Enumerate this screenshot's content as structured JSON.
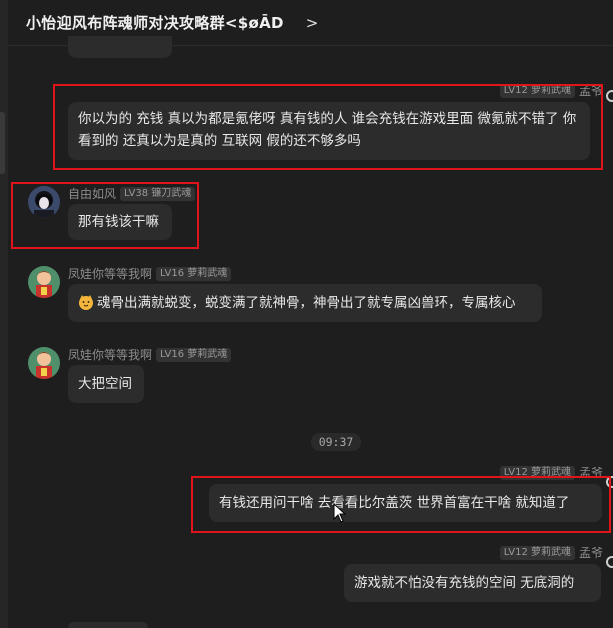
{
  "header": {
    "title": "小怡迎风布阵魂师对决攻略群<$øĀD",
    "chevron": ">"
  },
  "messages": [
    {
      "id": "m1",
      "side": "right",
      "name": "孟爷",
      "badge": "LV12 萝莉武魂",
      "text": "你以为的  充钱  真以为都是氪佬呀  真有钱的人  谁会充钱在游戏里面  微氪就不错了  你看到的  还真以为是真的  互联网  假的还不够多吗"
    },
    {
      "id": "m2",
      "side": "left",
      "name": "自由如风",
      "badge": "LV38 镰刀武魂",
      "avatar_icon": "dark-anime-avatar-icon",
      "text": "那有钱该干嘛"
    },
    {
      "id": "m3",
      "side": "left",
      "name": "凤娃你等等我啊",
      "badge": "LV16 萝莉武魂",
      "avatar_icon": "colorful-cartoon-avatar-icon",
      "emoji_icon": "cat-face-emoji-icon",
      "text": "魂骨出满就蜕变，蜕变满了就神骨，神骨出了就专属凶兽环，专属核心"
    },
    {
      "id": "m4",
      "side": "left",
      "name": "凤娃你等等我啊",
      "badge": "LV16 萝莉武魂",
      "avatar_icon": "colorful-cartoon-avatar-icon",
      "text": "大把空间"
    },
    {
      "id": "m5",
      "side": "right",
      "name": "孟爷",
      "badge": "LV12 萝莉武魂",
      "text": "有钱还用问干啥  去看看比尔盖茨  世界首富在干啥  就知道了"
    },
    {
      "id": "m6",
      "side": "right",
      "name": "孟爷",
      "badge": "LV12 萝莉武魂",
      "text": "游戏就不怕没有充钱的空间  无底洞的"
    }
  ],
  "time_divider": "09:37",
  "colors": {
    "background": "#1e1e1f",
    "bubble": "#2c2c2d",
    "highlight_box": "#e0141b"
  }
}
